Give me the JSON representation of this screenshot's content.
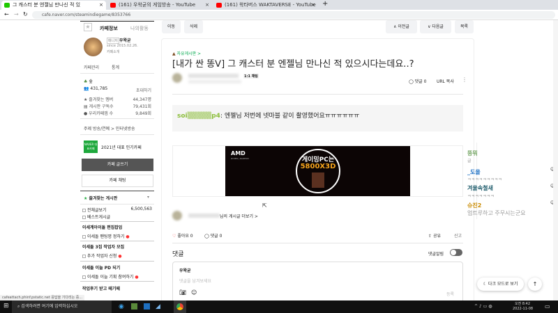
{
  "browser": {
    "tabs": [
      {
        "title": "그 캐스터 분 엔젤님 만나신 적 있"
      },
      {
        "title": "(161) 우왁굳의 게임방송 - YouTube"
      },
      {
        "title": "(161) 왁타버스 WAKTAVERSE - YouTube"
      }
    ],
    "new_tab": "+",
    "url": "cafe.naver.com/steamindiegame/8353766"
  },
  "sidebar": {
    "tab_info": "카페정보",
    "tab_activity": "나의활동",
    "manager_badge": "매니저",
    "manager": "우왁굳",
    "since": "since 2015.02.26.",
    "intro": "카페소개",
    "manage": "카페관리",
    "stats": "통계",
    "grade": "숲",
    "members": "431,785",
    "invite": "초대하기",
    "fav_members_label": "즐겨찾는 멤버",
    "fav_members": "44,347명",
    "board_sub_label": "게시판 구독수",
    "board_sub": "79,431회",
    "rep_label": "우리카페앱 수",
    "rep": "9,849회",
    "topic": "주제 방송/연예 > 인터넷방송",
    "naver_badge": "NAVER 대표카페",
    "award": "2021년 대표 인기카페",
    "write": "카페 글쓰기",
    "chat": "카페 채팅",
    "fav_boards": "즐겨찾는 게시판",
    "boards": [
      {
        "label": "전체글보기",
        "count": "6,500,563"
      },
      {
        "label": "베스트게시글",
        "count": ""
      }
    ],
    "sections": [
      {
        "title": "이세계아이돌 편집팝업",
        "items": [
          "이세돌 팬팅명 정하기"
        ]
      },
      {
        "title": "이세돌 3집 작업자 모집",
        "items": [
          "추가 작업자 신청"
        ]
      },
      {
        "title": "이세돌 이늘 PD 되기",
        "items": [
          "이세돌 이늘 기획 참여하기"
        ]
      },
      {
        "title": "작업후기 받고 떼기떼",
        "items": []
      }
    ]
  },
  "toolbar": {
    "move": "이동",
    "delete": "삭제",
    "prev": "∧ 이전글",
    "next": "∨ 다음글",
    "list": "목록"
  },
  "article": {
    "board": "자유게시판 >",
    "title": "[내가 싼 똥ᐯ] 그 캐스터 분 엔젤님 만나신 적 있으시다는데요..?",
    "chat_1to1": "1:1 채팅",
    "comments_count": "댓글 0",
    "url_copy": "URL 복사",
    "quote_user": "soi▒▒▒▒▒p4",
    "quote_text": ": 엔젤님 저번에 넷마블 같이 촬영했어요ㅠㅠㅠㅠㅠㅠ",
    "ad_brand": "AMD",
    "ad_sub": "RYZEN | RADEON",
    "ad_line1": "게이밍PC는",
    "ad_line2": "5800X3D",
    "more_posts": "님의 게시글 더보기 >",
    "like": "좋아요 0",
    "comment": "댓글 0",
    "share": "공유",
    "report": "신고"
  },
  "comments": {
    "title": "댓글",
    "notify": "댓글알림",
    "user": "우왁굳",
    "placeholder": "댓글을 남겨보세요",
    "submit": "등록"
  },
  "chat_overlay": [
    {
      "name": "뚱뭐",
      "msg": "글",
      "color": "#7aa86a"
    },
    {
      "name": "_도올",
      "msg": "ㅋㅋㅋㅋㅋㅋㅋㅋㅋ",
      "color": "#1b6fc4"
    },
    {
      "name": "겨울속철새",
      "msg": "ㅋㅋㅋㅋㅋㅋㅋ",
      "color": "#1c5a6a"
    },
    {
      "name": "슈진2",
      "msg": "업트루하고 주무시는군요",
      "color": "#c98a00"
    }
  ],
  "floating": {
    "dark_mode": "다크 모드로 보기",
    "top": "↑"
  },
  "status_url": "cafeattach.phinf.pstatic.net 응답을 기다리는 중...",
  "taskbar": {
    "search": "검색하려면 여기에 입력하십시오",
    "time": "오전 8:42",
    "date": "2022-11-08"
  }
}
